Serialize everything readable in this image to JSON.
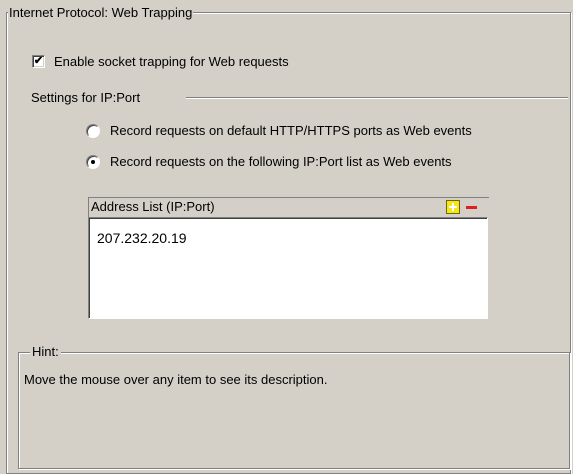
{
  "group": {
    "title": "Internet Protocol: Web Trapping"
  },
  "enable": {
    "label": "Enable socket trapping for Web requests",
    "checked": true
  },
  "settings": {
    "title": "Settings for IP:Port"
  },
  "radios": [
    {
      "label": "Record requests on default HTTP/HTTPS ports as Web events",
      "selected": false
    },
    {
      "label": "Record requests on the following IP:Port list as Web events",
      "selected": true
    }
  ],
  "address_list": {
    "header": "Address List (IP:Port)",
    "items": [
      "207.232.20.19"
    ],
    "add_icon": "plus-icon",
    "remove_icon": "minus-icon"
  },
  "hint": {
    "title": "Hint:",
    "text": "Move the mouse over any item to see its description."
  }
}
